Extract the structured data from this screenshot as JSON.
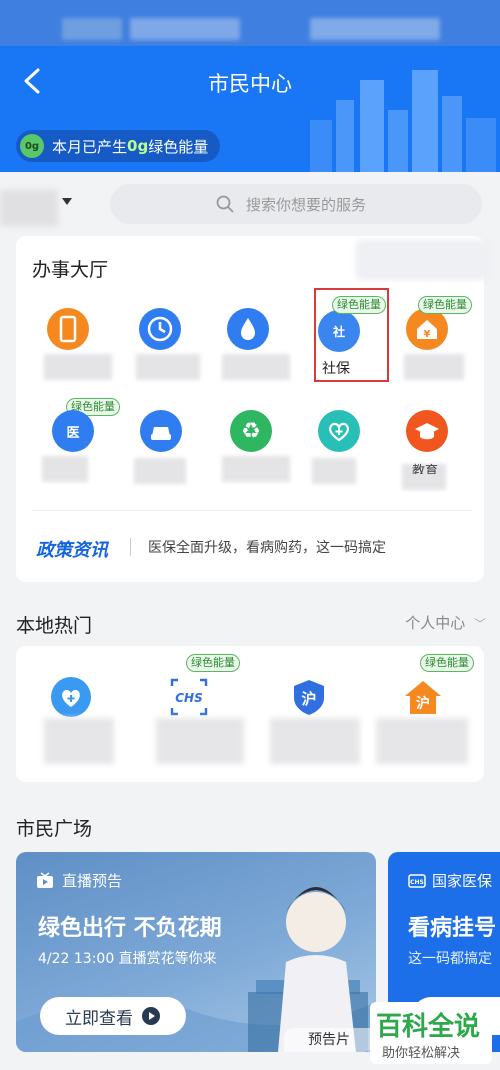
{
  "header": {
    "title": "市民中心",
    "energy_prefix": "本月已产生",
    "energy_value": "0g",
    "energy_suffix": "绿色能量",
    "energy_dot_text": "0g"
  },
  "search": {
    "placeholder": "搜索你想要的服务"
  },
  "office_hall": {
    "title": "办事大厅",
    "badge_text": "绿色能量",
    "selected_label": "社保",
    "icons": [
      {
        "name": "phone-icon",
        "color": "#f5891f",
        "glyph": "▯"
      },
      {
        "name": "clock-icon",
        "color": "#2f7df0",
        "glyph": "⟲"
      },
      {
        "name": "water-drop-icon",
        "color": "#2f7df0",
        "glyph": "💧"
      },
      {
        "name": "social-security-icon",
        "color": "#3a86ee",
        "glyph": "社"
      },
      {
        "name": "housing-fund-icon",
        "color": "#f5891f",
        "glyph": "¥"
      },
      {
        "name": "medical-insurance-icon",
        "color": "#2f7df0",
        "glyph": "医"
      },
      {
        "name": "car-icon",
        "color": "#2f7df0",
        "glyph": "🚗"
      },
      {
        "name": "recycle-icon",
        "color": "#2fb661",
        "glyph": "♻"
      },
      {
        "name": "health-icon",
        "color": "#27bfb6",
        "glyph": "✚"
      },
      {
        "name": "education-icon",
        "color": "#f0561e",
        "glyph": "🎓"
      }
    ],
    "row2_last_label": "教育"
  },
  "policy": {
    "logo": "政策资讯",
    "text": "医保全面升级，看病购药，这一码搞定"
  },
  "local_hot": {
    "title": "本地热门",
    "link": "个人中心",
    "badge_text": "绿色能量",
    "icons": [
      {
        "name": "heart-plus-icon",
        "color": "#2f8df0",
        "glyph": "♥"
      },
      {
        "name": "chs-icon",
        "color": "#2f6fe0",
        "glyph": "CHS"
      },
      {
        "name": "shanghai-shield-icon",
        "color": "#2f6fe0",
        "glyph": "沪"
      },
      {
        "name": "shanghai-house-icon",
        "color": "#f5891f",
        "glyph": "沪"
      }
    ]
  },
  "plaza": {
    "title": "市民广场",
    "promo1": {
      "tag": "直播预告",
      "headline": "绿色出行 不负花期",
      "sub": "4/22 13:00 直播赏花等你来",
      "button": "立即查看",
      "corner": "预告片"
    },
    "promo2": {
      "tag": "国家医保",
      "headline": "看病挂号",
      "sub": "这一码都搞定"
    }
  },
  "watermark": {
    "main": "百科全说",
    "sub": "助你轻松解决"
  }
}
